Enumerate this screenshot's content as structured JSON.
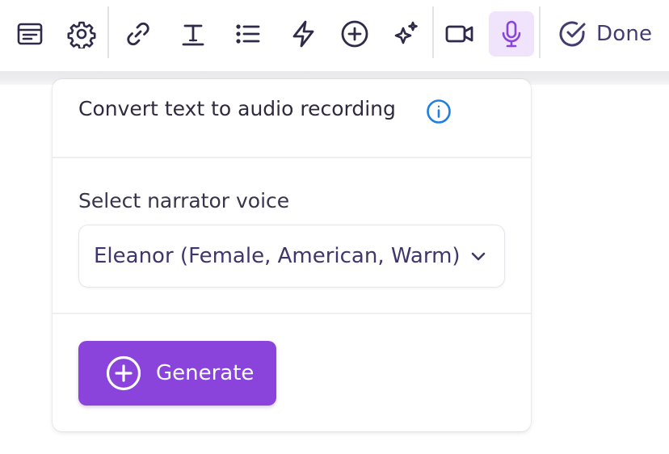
{
  "toolbar": {
    "buttons": [
      {
        "icon": "card-icon"
      },
      {
        "icon": "gear-icon"
      },
      {
        "icon": "link-icon"
      },
      {
        "icon": "text-icon"
      },
      {
        "icon": "list-icon"
      },
      {
        "icon": "lightning-icon"
      },
      {
        "icon": "plus-circle-icon"
      },
      {
        "icon": "sparkles-icon"
      },
      {
        "icon": "video-icon"
      },
      {
        "icon": "microphone-icon",
        "active": true
      }
    ],
    "done_label": "Done",
    "icon_color": "#2f2a4a",
    "active_icon_color": "#8a44dc",
    "active_bg": "#efe4fb"
  },
  "panel": {
    "title": "Convert text to audio recording",
    "info_icon": "info-icon",
    "info_color": "#1f7fe0",
    "voice_label": "Select narrator voice",
    "voice_selected": "Eleanor (Female, American, Warm)",
    "generate_label": "Generate",
    "generate_color": "#8a44dc"
  }
}
